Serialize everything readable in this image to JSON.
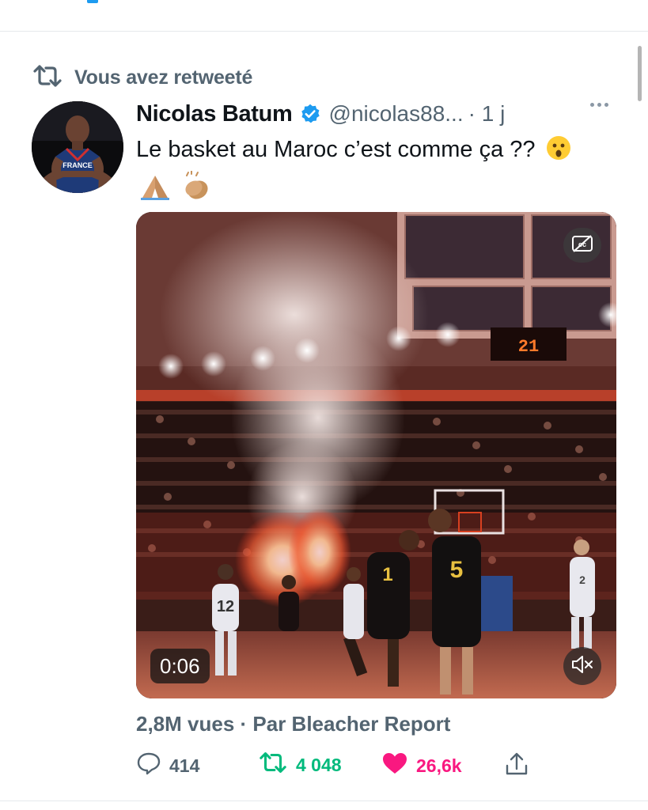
{
  "retweet_banner": {
    "text": "Vous avez retweeté"
  },
  "tweet": {
    "author": {
      "display_name": "Nicolas Batum",
      "handle": "@nicolas88...",
      "time": "· 1 j",
      "jersey_text": "FRANCE"
    },
    "text": "Le basket au Maroc c’est comme ça ??",
    "emojis": [
      "astonished-face",
      "folded-hands",
      "clapping-hands"
    ],
    "media": {
      "duration": "0:06",
      "scoreboard": "21",
      "player_numbers": [
        "12",
        "1",
        "5",
        "2"
      ]
    },
    "views_line": "2,8M vues · Par Bleacher Report",
    "actions": {
      "replies": "414",
      "retweets": "4 048",
      "likes": "26,6k"
    }
  },
  "colors": {
    "retweet_green": "#00ba7c",
    "like_pink": "#f91880",
    "verified_blue": "#1d9bf0",
    "secondary_text": "#536471"
  }
}
